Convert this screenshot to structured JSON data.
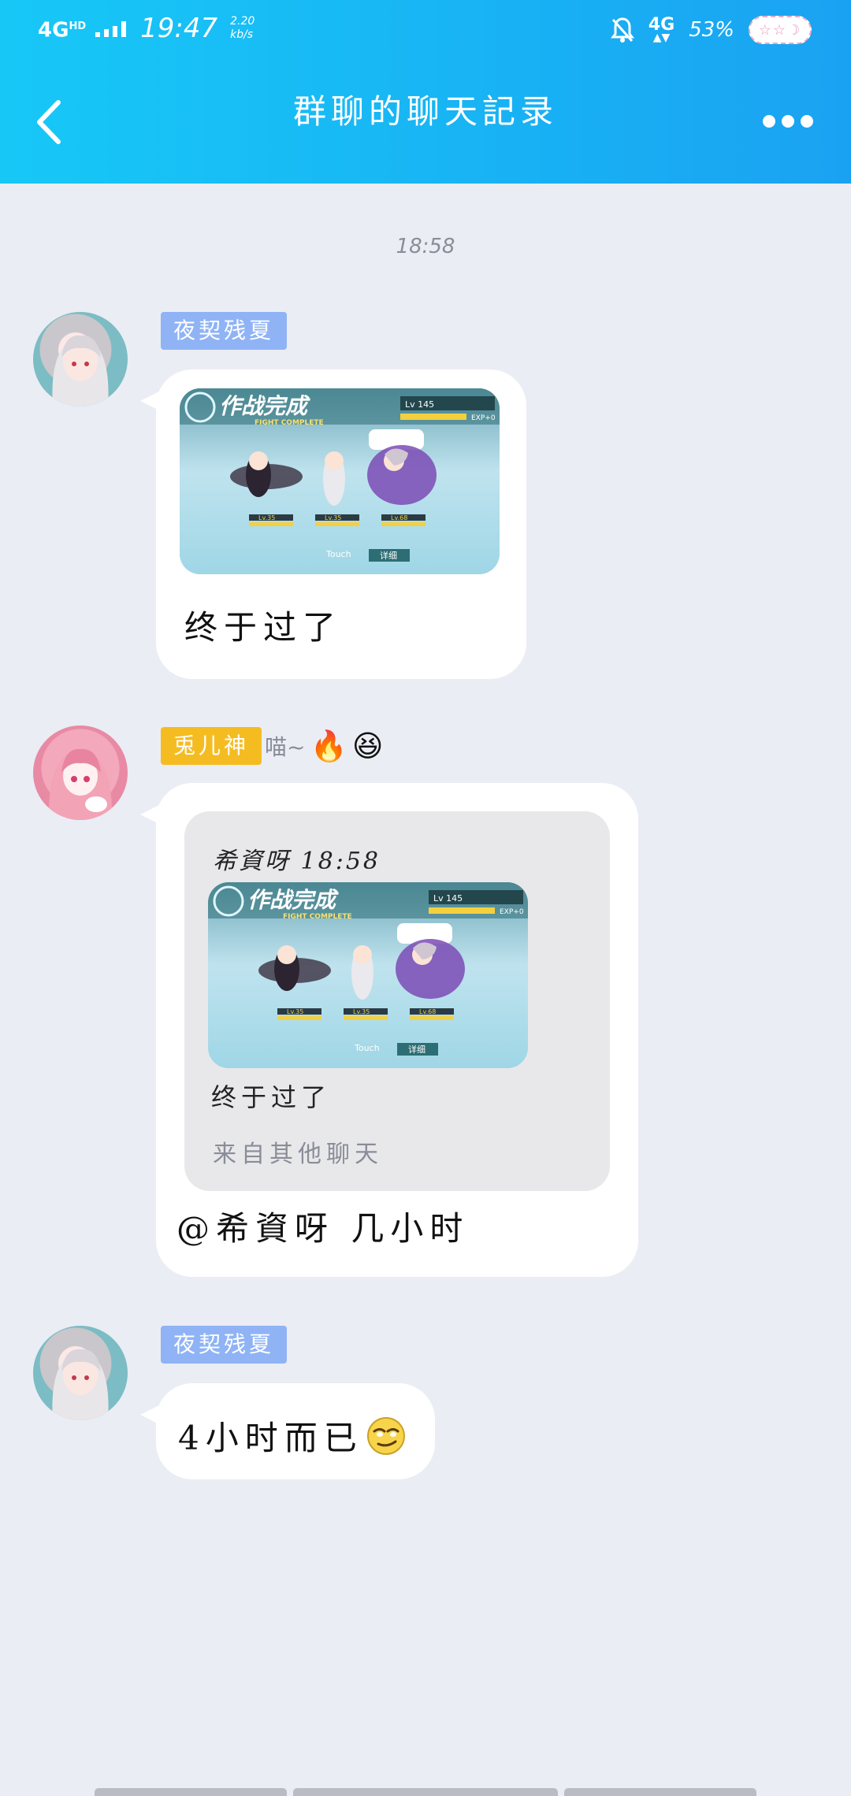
{
  "status_bar": {
    "network_type": "4G",
    "network_hd": "HD",
    "time": "19:47",
    "speed_value": "2.20",
    "speed_unit": "kb/s",
    "mobile_data": "4G",
    "battery": "53%",
    "pill_glyphs": "☆☆☽"
  },
  "header": {
    "title": "群聊的聊天記录",
    "back_icon": "chevron-left-icon",
    "more_icon": "more-horizontal-icon"
  },
  "timestamp": "18:58",
  "game_screenshot": {
    "banner": "作战完成",
    "subbanner": "FIGHT COMPLETE",
    "level": "Lv 145",
    "exp": "EXP+0",
    "touch": "Touch",
    "detail": "详细",
    "char_levels": [
      "Lv.35",
      "Lv.35",
      "Lv.68"
    ]
  },
  "messages": [
    {
      "sender": "夜契残夏",
      "text": "终于过了"
    },
    {
      "sender": "兎儿神",
      "sender_suffix": "喵~",
      "sender_emojis": [
        "🔥",
        "😆"
      ],
      "quote": {
        "author": "希資呀 18:58",
        "text": "终于过了",
        "source": "来自其他聊天"
      },
      "text": "@希資呀 几小时"
    },
    {
      "sender": "夜契残夏",
      "text": "4小时而已"
    }
  ],
  "colors": {
    "header_start": "#17c8f7",
    "header_end": "#1aa2f2",
    "background": "#eaedf4",
    "tag_blue": "#8fb3f5",
    "tag_yellow": "#f5bc22"
  }
}
